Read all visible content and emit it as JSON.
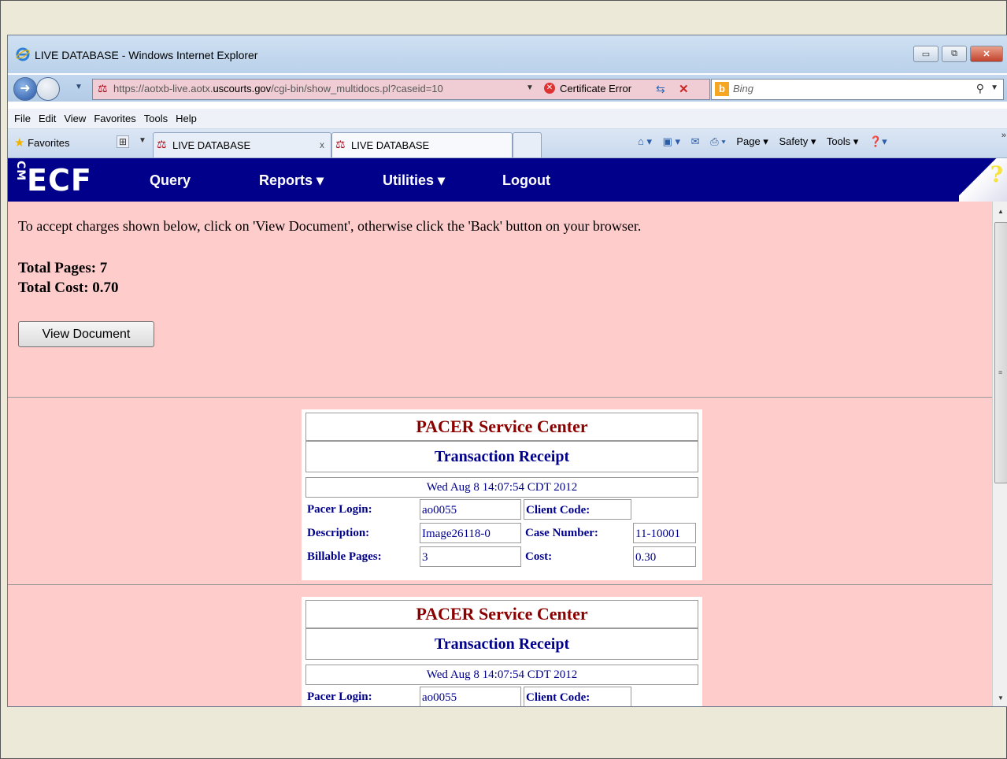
{
  "window": {
    "title": "LIVE DATABASE - Windows Internet Explorer",
    "controls": {
      "minimize": "▭",
      "restore": "⧉",
      "close": "✕"
    }
  },
  "address_bar": {
    "url_prefix": "https://aotxb-live.aotx.",
    "url_domain": "uscourts.gov",
    "url_suffix": "/cgi-bin/show_multidocs.pl?caseid=10",
    "certificate_error": "Certificate Error",
    "search_placeholder": "Bing"
  },
  "menu": [
    "File",
    "Edit",
    "View",
    "Favorites",
    "Tools",
    "Help"
  ],
  "favorites_label": "Favorites",
  "tabs": [
    {
      "label": "LIVE DATABASE",
      "close": "x"
    },
    {
      "label": "LIVE DATABASE"
    }
  ],
  "command_bar": {
    "page": "Page ▾",
    "safety": "Safety ▾",
    "tools": "Tools ▾"
  },
  "ecf": {
    "logo": "ECF",
    "logo_prefix": "CM",
    "nav": [
      {
        "label": "Query"
      },
      {
        "label": "Reports ▾"
      },
      {
        "label": "Utilities ▾"
      },
      {
        "label": "Logout"
      }
    ],
    "help": "?"
  },
  "page": {
    "intro": "To accept charges shown below, click on 'View Document', otherwise click the 'Back' button on your browser.",
    "total_pages": "Total Pages: 7",
    "total_cost": "Total Cost: 0.70",
    "view_button": "View Document"
  },
  "receipts": [
    {
      "title": "PACER Service Center",
      "subtitle": "Transaction Receipt",
      "datetime": "Wed Aug 8 14:07:54 CDT 2012",
      "labels": {
        "login": "Pacer Login:",
        "client": "Client Code:",
        "desc": "Description:",
        "case": "Case Number:",
        "pages": "Billable Pages:",
        "cost": "Cost:"
      },
      "login": "ao0055",
      "client_code": "",
      "description": "Image26118-0",
      "case_number": "11-10001",
      "billable_pages": "3",
      "cost": "0.30"
    },
    {
      "title": "PACER Service Center",
      "subtitle": "Transaction Receipt",
      "datetime": "Wed Aug 8 14:07:54 CDT 2012",
      "labels": {
        "login": "Pacer Login:",
        "client": "Client Code:"
      },
      "login": "ao0055"
    }
  ]
}
